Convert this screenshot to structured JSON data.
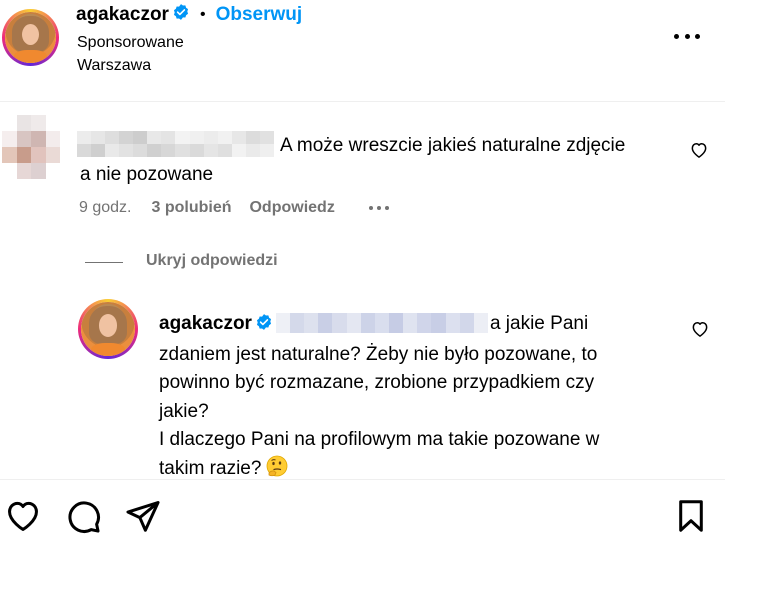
{
  "header": {
    "username": "agakaczor",
    "dot": "•",
    "follow_label": "Obserwuj",
    "sponsored": "Sponsorowane",
    "location": "Warszawa"
  },
  "comment": {
    "text_line1": "A może wreszcie jakieś naturalne zdjęcie",
    "text_line2": "a nie pozowane",
    "time": "9 godz.",
    "likes": "3 polubień",
    "reply_label": "Odpowiedz"
  },
  "replies_toggle": {
    "label": "Ukryj odpowiedzi"
  },
  "reply": {
    "username": "agakaczor",
    "text_after_mention": "a jakie Pani",
    "line2": "zdaniem jest naturalne? Żeby nie było pozowane, to",
    "line3": "powinno być rozmazane, zrobione przypadkiem czy",
    "line4": "jakie?",
    "line5": "I dlaczego Pani na profilowym ma takie pozowane w",
    "line6": "takim razie?"
  },
  "icons": {
    "header_more": "more-horizontal-icon",
    "verified": "verified-badge-icon",
    "comment_like": "heart-icon",
    "reply_like": "heart-icon",
    "emoji": "thinking-face-emoji-icon",
    "like": "heart-icon",
    "comment": "comment-bubble-icon",
    "share": "paper-plane-icon",
    "save": "bookmark-icon"
  },
  "colors": {
    "link_blue": "#0095f6",
    "verified_blue": "#0095f6",
    "meta_gray": "#737373"
  }
}
